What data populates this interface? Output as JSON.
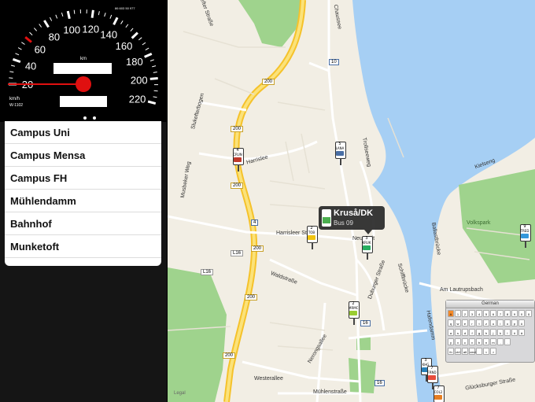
{
  "speedometer": {
    "ticks": [
      "20",
      "40",
      "60",
      "80",
      "100",
      "120",
      "140",
      "160",
      "180",
      "200",
      "220"
    ],
    "unit_km": "km",
    "unit_kmh": "km/h",
    "model_code": "W-1102",
    "small_print": "86 603 50 977",
    "accent_red": "#e01010"
  },
  "stops": [
    {
      "label": "Campus Uni"
    },
    {
      "label": "Campus Mensa"
    },
    {
      "label": "Campus FH"
    },
    {
      "label": "Mühlendamm"
    },
    {
      "label": "Bahnhof"
    },
    {
      "label": "Munketoft"
    }
  ],
  "map": {
    "street_labels": {
      "s1": "Slukefter Straße",
      "s2": "Chaussee",
      "s3": "Slukefterbogen",
      "s4": "Trollseeweg",
      "s5": "Kielseng",
      "s6": "Musbeker Weg",
      "s7": "Harrislee",
      "s8": "Harrisleer Straße",
      "s9": "Waldstraße",
      "s10": "Ballastbrücke",
      "s11": "Schiffbrücke",
      "s12": "Am Lautrupsbach",
      "s13": "Hafendamm",
      "s14": "Nerongsallee",
      "s15": "Westerallee",
      "s16": "Mühlenstraße",
      "s17": "Glücksburger Straße",
      "s18": "Duburger Straße",
      "s19": "Volkspark",
      "s20": "Legal",
      "s21": "Neustadt"
    },
    "road_signs": {
      "r1": "10",
      "r2": "200",
      "r3": "200",
      "r4": "200",
      "r5": "4",
      "r6": "200",
      "r7": "L16",
      "r8": "L16",
      "r9": "200",
      "r10": "200",
      "r11": "16",
      "r12": "16"
    },
    "callout": {
      "title": "Kruså/DK",
      "subtitle": "Bus 09"
    },
    "buses": [
      {
        "num": "4",
        "code": "CRUN",
        "color": "#c0392b"
      },
      {
        "num": "5",
        "code": "LANA",
        "color": "#4a6fa5"
      },
      {
        "num": "2",
        "code": "TOB",
        "color": "#f1c40f"
      },
      {
        "num": "3",
        "code": "KRUK",
        "color": "#27ae60"
      },
      {
        "num": "2",
        "code": "MRMC",
        "color": "#9acd32"
      },
      {
        "num": "3",
        "code": "KHG",
        "color": "#2980b9"
      },
      {
        "num": "7",
        "code": "FRND",
        "color": "#e74c3c"
      },
      {
        "num": "7",
        "code": "COL2",
        "color": "#e67e22"
      },
      {
        "num": "9",
        "code": "TRED",
        "color": "#3498db"
      }
    ]
  },
  "keyboard": {
    "title": "German",
    "row1": [
      "A",
      "1",
      "2",
      "3",
      "4",
      "5",
      "6",
      "7",
      "8",
      "9",
      "0",
      "ß"
    ],
    "row2": [
      "q",
      "w",
      "e",
      "r",
      "t",
      "z",
      "u",
      "i",
      "o",
      "p",
      "ü"
    ],
    "row3": [
      "a",
      "s",
      "d",
      "f",
      "g",
      "h",
      "j",
      "k",
      "l",
      "ö",
      "ä"
    ],
    "row4": [
      "y",
      "x",
      "c",
      "v",
      "b",
      "n",
      "m",
      ",",
      "."
    ],
    "row5": [
      "fn",
      "ctrl",
      "alt",
      "cmd",
      " ",
      "<",
      ">"
    ]
  }
}
